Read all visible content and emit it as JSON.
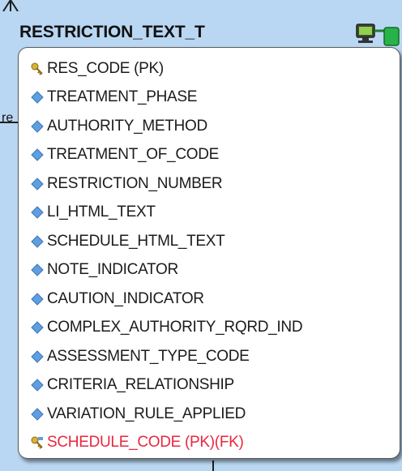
{
  "table": {
    "title": "RESTRICTION_TEXT_T",
    "attributes": [
      {
        "label": "RES_CODE (PK)",
        "kind": "primary-key",
        "icon": "key-icon"
      },
      {
        "label": "TREATMENT_PHASE",
        "kind": "attribute",
        "icon": "diamond-icon"
      },
      {
        "label": "AUTHORITY_METHOD",
        "kind": "attribute",
        "icon": "diamond-icon"
      },
      {
        "label": "TREATMENT_OF_CODE",
        "kind": "attribute",
        "icon": "diamond-icon"
      },
      {
        "label": "RESTRICTION_NUMBER",
        "kind": "attribute",
        "icon": "diamond-icon"
      },
      {
        "label": "LI_HTML_TEXT",
        "kind": "attribute",
        "icon": "diamond-icon"
      },
      {
        "label": "SCHEDULE_HTML_TEXT",
        "kind": "attribute",
        "icon": "diamond-icon"
      },
      {
        "label": "NOTE_INDICATOR",
        "kind": "attribute",
        "icon": "diamond-icon"
      },
      {
        "label": "CAUTION_INDICATOR",
        "kind": "attribute",
        "icon": "diamond-icon"
      },
      {
        "label": "COMPLEX_AUTHORITY_RQRD_IND",
        "kind": "attribute",
        "icon": "diamond-icon"
      },
      {
        "label": "ASSESSMENT_TYPE_CODE",
        "kind": "attribute",
        "icon": "diamond-icon"
      },
      {
        "label": "CRITERIA_RELATIONSHIP",
        "kind": "attribute",
        "icon": "diamond-icon"
      },
      {
        "label": "VARIATION_RULE_APPLIED",
        "kind": "attribute",
        "icon": "diamond-icon"
      },
      {
        "label": "SCHEDULE_CODE (PK)(FK)",
        "kind": "primary-foreign-key",
        "icon": "key-link-icon"
      }
    ]
  },
  "left_fragment": "re",
  "colors": {
    "background": "#b9d7f2",
    "fk_text": "#e8273f",
    "attribute_icon": "#5f9fe0",
    "key_icon": "#d9b23a"
  }
}
